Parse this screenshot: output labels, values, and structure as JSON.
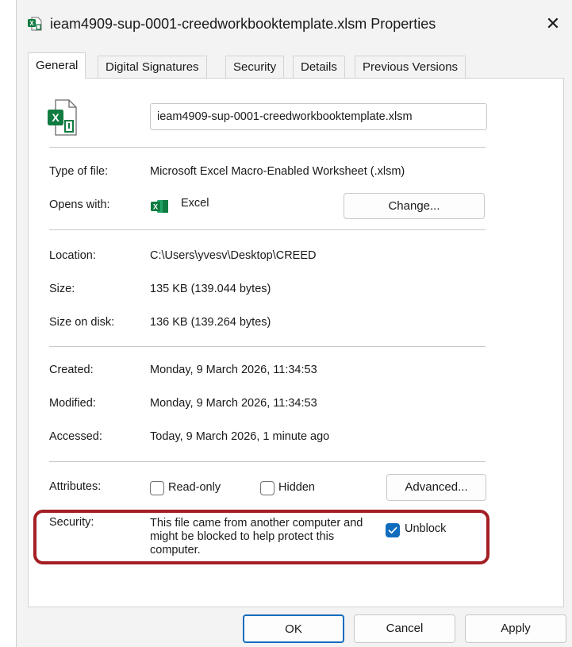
{
  "window": {
    "title": "ieam4909-sup-0001-creedworkbooktemplate.xlsm Properties",
    "close_glyph": "✕",
    "title_icon": "excel-file-icon"
  },
  "tabs": [
    {
      "label": "General",
      "active": true
    },
    {
      "label": "Digital Signatures",
      "active": false
    },
    {
      "label": "Security",
      "active": false
    },
    {
      "label": "Details",
      "active": false
    },
    {
      "label": "Previous Versions",
      "active": false
    }
  ],
  "general": {
    "file_icon": "excel-macro-file-icon",
    "file_name": "ieam4909-sup-0001-creedworkbooktemplate.xlsm",
    "type_label": "Type of file:",
    "type_value": "Microsoft Excel Macro-Enabled Worksheet (.xlsm)",
    "opens_label": "Opens with:",
    "opens_app": "Excel",
    "opens_app_icon": "excel-app-icon",
    "change_button": "Change...",
    "location_label": "Location:",
    "location_value": "C:\\Users\\yvesv\\Desktop\\CREED",
    "size_label": "Size:",
    "size_value": "135 KB (139.044 bytes)",
    "size_on_disk_label": "Size on disk:",
    "size_on_disk_value": "136 KB (139.264 bytes)",
    "created_label": "Created:",
    "created_value": "Monday, 9 March 2026, 11:34:53",
    "modified_label": "Modified:",
    "modified_value": "Monday, 9 March 2026, 11:34:53",
    "accessed_label": "Accessed:",
    "accessed_value": "Today, 9 March 2026, 1 minute ago",
    "attributes_label": "Attributes:",
    "readonly_label": "Read-only",
    "readonly_checked": false,
    "hidden_label": "Hidden",
    "hidden_checked": false,
    "advanced_button": "Advanced...",
    "security_label": "Security:",
    "security_text": "This file came from another computer and might be blocked to help protect this computer.",
    "unblock_label": "Unblock",
    "unblock_checked": true
  },
  "footer": {
    "ok": "OK",
    "cancel": "Cancel",
    "apply": "Apply"
  },
  "colors": {
    "accent": "#0f6cbd",
    "excel_green": "#107c41",
    "highlight_red": "#a31f24"
  }
}
